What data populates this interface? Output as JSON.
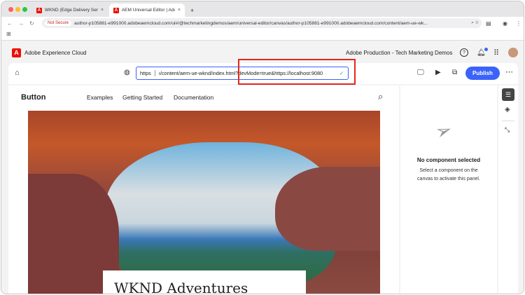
{
  "browser": {
    "tabs": [
      {
        "label": "WKND (Edge Delivery Servic"
      },
      {
        "label": "AEM Universal Editor | Adob"
      }
    ],
    "not_secure": "Not Secure",
    "url": "author-p105881-e991000.adobeaemcloud.com/ui#/@techmarketingdemos/aem/universal-editor/canvas/author-p105881-e991000.adobeaemcloud.com/content/aem-ue-wk..."
  },
  "header": {
    "brand": "Adobe Experience Cloud",
    "org": "Adobe Production - Tech Marketing Demos"
  },
  "toolbar": {
    "scheme": "https",
    "location": "ı/content/aem-ue-wknd/index.html?devMode=true&https://localhost:9080",
    "publish": "Publish"
  },
  "site": {
    "brand": "Button",
    "nav": [
      "Examples",
      "Getting Started",
      "Documentation"
    ],
    "hero_title": "WKND Adventures"
  },
  "panel": {
    "title": "No component selected",
    "body": "Select a component on the canvas to activate this panel."
  },
  "colors": {
    "accent": "#3b63fb",
    "highlight": "#e0281c",
    "adobe_red": "#eb1000"
  }
}
